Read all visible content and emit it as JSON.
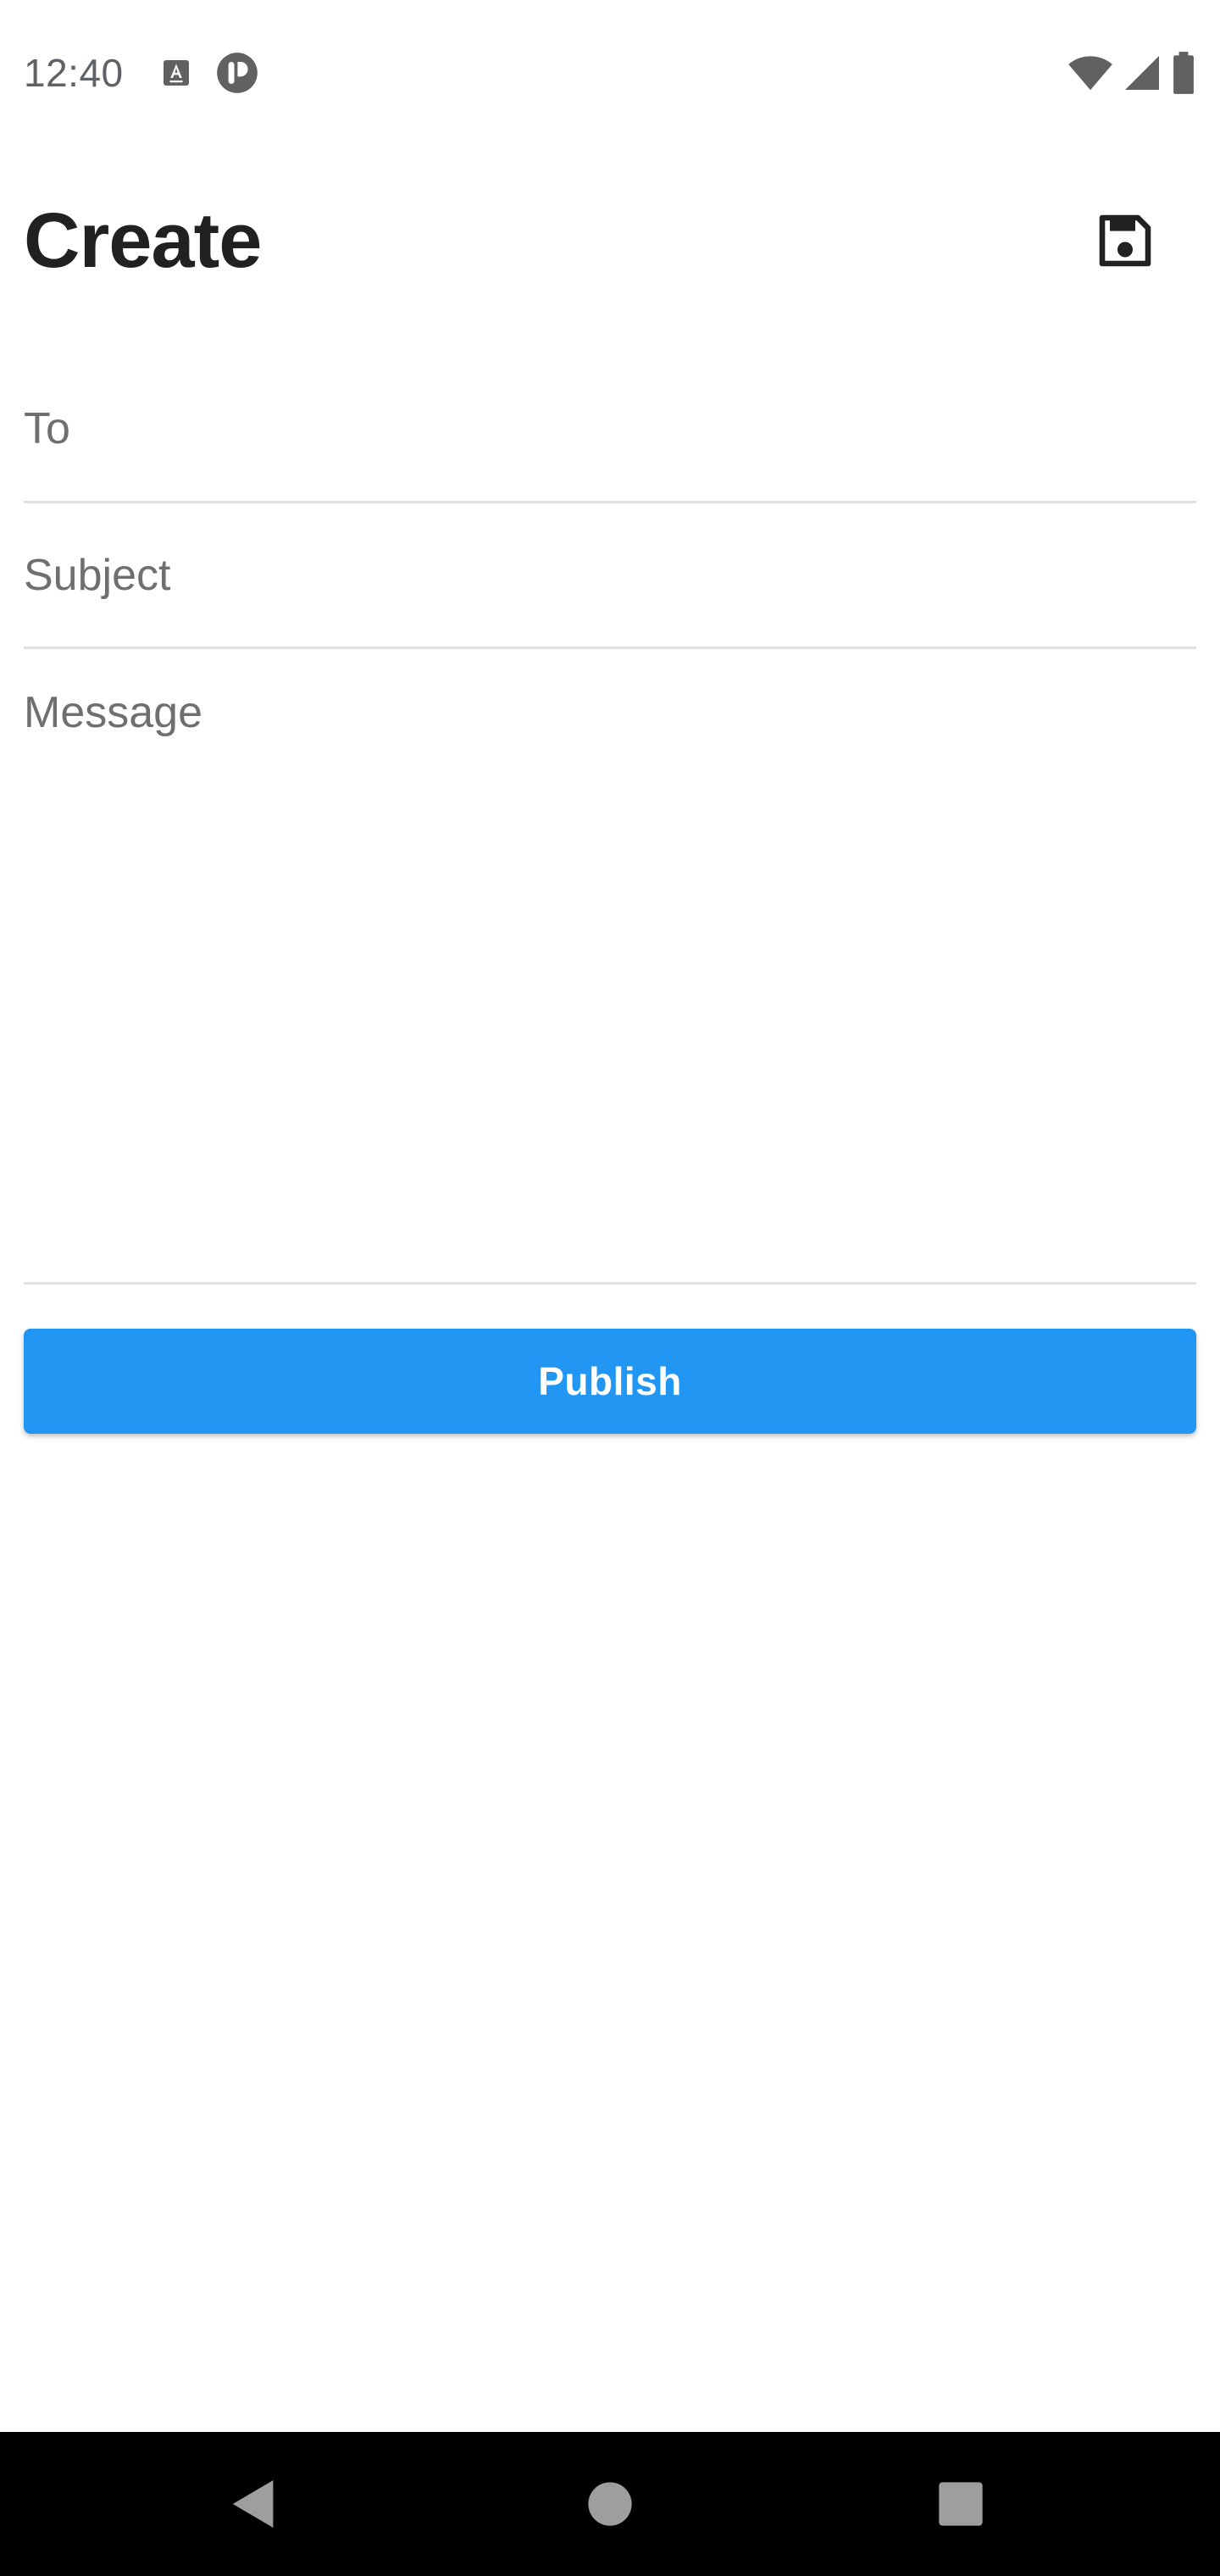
{
  "status_bar": {
    "time": "12:40",
    "left_icons": [
      "keyboard-icon",
      "app-notification-icon"
    ],
    "right_icons": [
      "wifi-icon",
      "cell-signal-icon",
      "battery-icon"
    ]
  },
  "header": {
    "title": "Create",
    "save_icon": "save-icon"
  },
  "form": {
    "to": {
      "value": "",
      "placeholder": "To"
    },
    "subject": {
      "value": "",
      "placeholder": "Subject"
    },
    "message": {
      "value": "",
      "placeholder": "Message"
    }
  },
  "actions": {
    "publish_label": "Publish"
  },
  "nav_bar": {
    "buttons": [
      "back-icon",
      "home-icon",
      "recents-icon"
    ]
  },
  "colors": {
    "accent": "#2196f3",
    "text": "#212121",
    "placeholder": "#6f6f6f",
    "divider": "#e0e0e0",
    "nav_bar": "#000000"
  }
}
